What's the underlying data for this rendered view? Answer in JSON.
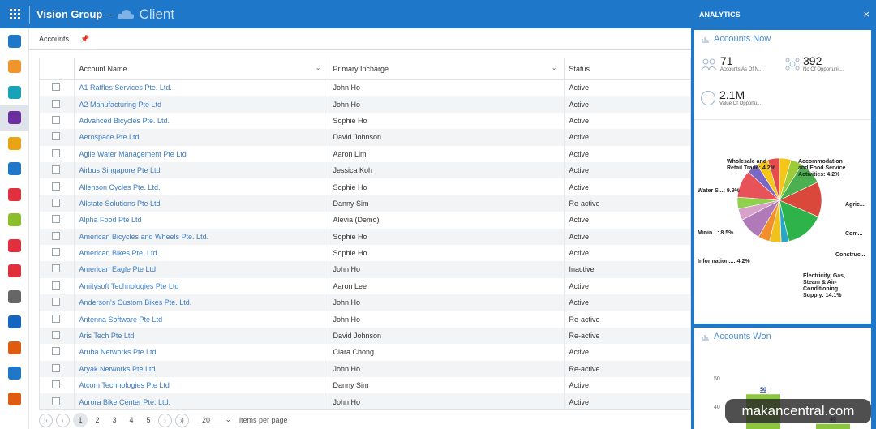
{
  "header": {
    "org": "Vision Group",
    "separator": "–",
    "app": "Client"
  },
  "sidebar": {
    "icons": [
      {
        "name": "dashboard-icon",
        "color": "#1f77c9"
      },
      {
        "name": "folder-icon",
        "color": "#f0952e"
      },
      {
        "name": "contacts-icon",
        "color": "#17a2b8"
      },
      {
        "name": "accounts-icon",
        "color": "#6b2fa0",
        "active": true
      },
      {
        "name": "target-icon",
        "color": "#e8a317"
      },
      {
        "name": "documents-icon",
        "color": "#1f77c9"
      },
      {
        "name": "campaign-icon",
        "color": "#e0303e"
      },
      {
        "name": "money-icon",
        "color": "#8bbf2a"
      },
      {
        "name": "leads-icon",
        "color": "#e0303e"
      },
      {
        "name": "tickets-icon",
        "color": "#e0303e"
      },
      {
        "name": "calculator-icon",
        "color": "#666666"
      },
      {
        "name": "outlook-icon",
        "color": "#1565c0"
      },
      {
        "name": "speedometer-icon",
        "color": "#e05b12"
      },
      {
        "name": "cloud-icon",
        "color": "#1f77c9"
      },
      {
        "name": "support-icon",
        "color": "#e05b12"
      }
    ]
  },
  "breadcrumb": {
    "label": "Accounts"
  },
  "table": {
    "columns": [
      "Account Name",
      "Primary Incharge",
      "Status"
    ],
    "rows": [
      {
        "name": "A1 Raffles Services Pte. Ltd.",
        "incharge": "John Ho",
        "status": "Active"
      },
      {
        "name": "A2 Manufacturing Pte Ltd",
        "incharge": "John Ho",
        "status": "Active"
      },
      {
        "name": "Advanced Bicycles Pte. Ltd.",
        "incharge": "Sophie Ho",
        "status": "Active"
      },
      {
        "name": "Aerospace Pte Ltd",
        "incharge": "David Johnson",
        "status": "Active"
      },
      {
        "name": "Agile Water Management Pte Ltd",
        "incharge": "Aaron Lim",
        "status": "Active"
      },
      {
        "name": "Airbus Singapore Pte Ltd",
        "incharge": "Jessica Koh",
        "status": "Active"
      },
      {
        "name": "Allenson Cycles Pte. Ltd.",
        "incharge": "Sophie Ho",
        "status": "Active"
      },
      {
        "name": "Allstate Solutions Pte Ltd",
        "incharge": "Danny Sim",
        "status": "Re-active"
      },
      {
        "name": "Alpha Food Pte Ltd",
        "incharge": "Alevia (Demo)",
        "status": "Active"
      },
      {
        "name": "American Bicycles and Wheels Pte. Ltd.",
        "incharge": "Sophie Ho",
        "status": "Active"
      },
      {
        "name": "American Bikes Pte. Ltd.",
        "incharge": "Sophie Ho",
        "status": "Active"
      },
      {
        "name": "American Eagle Pte Ltd",
        "incharge": "John Ho",
        "status": "Inactive"
      },
      {
        "name": "Amitysoft Technologies Pte Ltd",
        "incharge": "Aaron Lee",
        "status": "Active"
      },
      {
        "name": "Anderson's Custom Bikes Pte. Ltd.",
        "incharge": "John Ho",
        "status": "Active"
      },
      {
        "name": "Antenna Software Pte Ltd",
        "incharge": "John Ho",
        "status": "Re-active"
      },
      {
        "name": "Aris Tech Pte Ltd",
        "incharge": "David Johnson",
        "status": "Re-active"
      },
      {
        "name": "Aruba Networks Pte Ltd",
        "incharge": "Clara Chong",
        "status": "Active"
      },
      {
        "name": "Aryak Networks Pte Ltd",
        "incharge": "John Ho",
        "status": "Re-active"
      },
      {
        "name": "Atcom Technologies Pte Ltd",
        "incharge": "Danny Sim",
        "status": "Active"
      },
      {
        "name": "Aurora Bike Center Pte. Ltd.",
        "incharge": "John Ho",
        "status": "Active"
      }
    ]
  },
  "pager": {
    "pages": [
      "1",
      "2",
      "3",
      "4",
      "5"
    ],
    "current": "1",
    "page_size": "20",
    "label": "items per page"
  },
  "analytics": {
    "title": "ANALYTICS",
    "close": "×",
    "accounts_now": {
      "title": "Accounts Now",
      "kpis": [
        {
          "value": "71",
          "label": "Accounts As Of N..."
        },
        {
          "value": "392",
          "label": "No Of Opportunit..."
        },
        {
          "value": "2.1M",
          "label": "Value Of Opportu..."
        }
      ]
    },
    "accounts_won": {
      "title": "Accounts Won",
      "axis": [
        "50",
        "40"
      ]
    }
  },
  "chart_data": [
    {
      "type": "pie",
      "title": "",
      "slices": [
        {
          "label": "Accommodation and Food Service Activities: 4.2%",
          "value": 4.2,
          "color": "#f5c518"
        },
        {
          "label": "Agric...",
          "value": 4.2,
          "color": "#9ccc3c"
        },
        {
          "label": "Com...",
          "value": 8.5,
          "color": "#4caf50"
        },
        {
          "label": "Construc...",
          "value": 12.7,
          "color": "#d9483b"
        },
        {
          "label": "Electricity, Gas, Steam & Air-Conditioning Supply: 14.1%",
          "value": 14.1,
          "color": "#2db34a"
        },
        {
          "label": "",
          "value": 2.8,
          "color": "#26a6c9"
        },
        {
          "label": "Information...: 4.2%",
          "value": 4.2,
          "color": "#f1c21b"
        },
        {
          "label": "",
          "value": 4.2,
          "color": "#f28e2b"
        },
        {
          "label": "Minin...: 8.5%",
          "value": 8.5,
          "color": "#b07ab8"
        },
        {
          "label": "",
          "value": 4.2,
          "color": "#d6a2c9"
        },
        {
          "label": "",
          "value": 4.2,
          "color": "#8fd14f"
        },
        {
          "label": "Water S...: 9.9%",
          "value": 9.9,
          "color": "#e8535a"
        },
        {
          "label": "",
          "value": 4.1,
          "color": "#7b68c6"
        },
        {
          "label": "Wholesale and Retail Trade: 4.2%",
          "value": 4.2,
          "color": "#f5c518"
        },
        {
          "label": "",
          "value": 4.2,
          "color": "#e74c4c"
        }
      ]
    },
    {
      "type": "bar",
      "title": "Accounts Won",
      "categories": [
        "",
        ""
      ],
      "values": [
        50,
        40
      ],
      "ylim": [
        35,
        55
      ],
      "data_labels": [
        "50",
        "40"
      ],
      "colors": [
        "#8cc63f",
        "#8cc63f"
      ]
    }
  ],
  "watermark": "makancentral.com"
}
